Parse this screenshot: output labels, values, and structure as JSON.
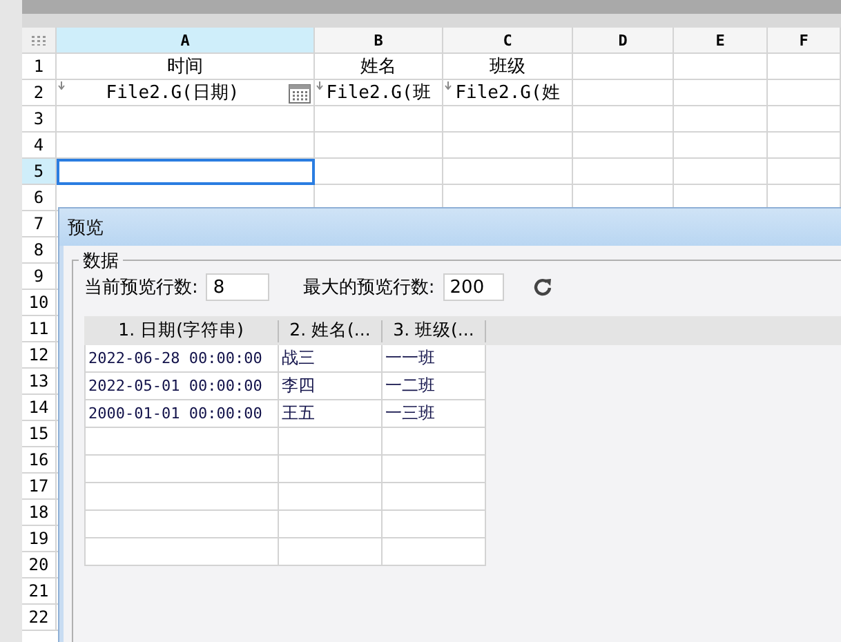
{
  "sheet": {
    "columns": [
      {
        "label": "A",
        "selected": true
      },
      {
        "label": "B",
        "selected": false
      },
      {
        "label": "C",
        "selected": false
      },
      {
        "label": "D",
        "selected": false
      },
      {
        "label": "E",
        "selected": false
      },
      {
        "label": "F",
        "selected": false
      }
    ],
    "rows": [
      {
        "label": "1",
        "selected": false,
        "cells": [
          {
            "text": "时间",
            "kind": "text"
          },
          {
            "text": "姓名",
            "kind": "text"
          },
          {
            "text": "班级",
            "kind": "text"
          }
        ]
      },
      {
        "label": "2",
        "selected": false,
        "cells": [
          {
            "text": "File2.G(日期)",
            "kind": "date-field"
          },
          {
            "text": "File2.G(班",
            "kind": "field"
          },
          {
            "text": "File2.G(姓",
            "kind": "field"
          }
        ]
      },
      {
        "label": "3",
        "selected": false,
        "cells": []
      },
      {
        "label": "4",
        "selected": false,
        "cells": []
      },
      {
        "label": "5",
        "selected": true,
        "cells": []
      },
      {
        "label": "6",
        "selected": false,
        "cells": []
      },
      {
        "label": "7",
        "selected": false,
        "cells": []
      },
      {
        "label": "8",
        "selected": false,
        "cells": []
      },
      {
        "label": "9",
        "selected": false,
        "cells": []
      },
      {
        "label": "10",
        "selected": false,
        "cells": []
      },
      {
        "label": "11",
        "selected": false,
        "cells": []
      },
      {
        "label": "12",
        "selected": false,
        "cells": []
      },
      {
        "label": "13",
        "selected": false,
        "cells": []
      },
      {
        "label": "14",
        "selected": false,
        "cells": []
      },
      {
        "label": "15",
        "selected": false,
        "cells": []
      },
      {
        "label": "16",
        "selected": false,
        "cells": []
      },
      {
        "label": "17",
        "selected": false,
        "cells": []
      },
      {
        "label": "18",
        "selected": false,
        "cells": []
      },
      {
        "label": "19",
        "selected": false,
        "cells": []
      },
      {
        "label": "20",
        "selected": false,
        "cells": []
      },
      {
        "label": "21",
        "selected": false,
        "cells": []
      },
      {
        "label": "22",
        "selected": false,
        "cells": []
      }
    ]
  },
  "dialog": {
    "title": "预览",
    "group": "数据",
    "current_rows": {
      "label": "当前预览行数:",
      "value": "8"
    },
    "max_rows": {
      "label": "最大的预览行数:",
      "value": "200"
    },
    "table": {
      "columns": [
        "1. 日期(字符串)",
        "2. 姓名(...",
        "3. 班级(..."
      ],
      "rows": [
        [
          "2022-06-28 00:00:00",
          "战三",
          "一一班"
        ],
        [
          "2022-05-01 00:00:00",
          "李四",
          "一二班"
        ],
        [
          "2000-01-01 00:00:00",
          "王五",
          "一三班"
        ],
        [],
        [],
        [],
        [],
        []
      ]
    }
  }
}
